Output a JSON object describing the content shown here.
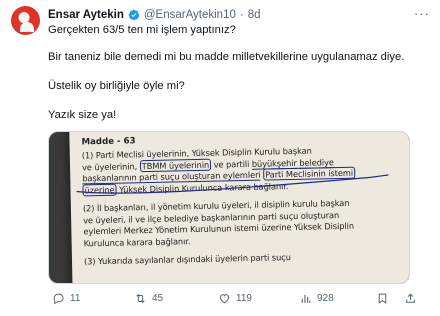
{
  "post": {
    "author_name": "Ensar Aytekin",
    "author_handle": "@EnsarAytekin10",
    "separator": "·",
    "time": "8d",
    "more_icon": "ellipsis-icon",
    "lines": [
      "Gerçekten 63/5 ten mi işlem yaptınız?",
      "Bir taneniz bile demedi mi bu  madde milletvekillerine uygulanamaz diye.",
      "Üstelik oy birliğiyle öyle mi?",
      "Yazık size ya!"
    ]
  },
  "image": {
    "title": "Madde - 63",
    "p1": {
      "l1": "(1)  Parti  Meclisi  üyelerinin,  Yüksek  Disiplin  Kurulu  başkan",
      "l2a": "ve üyelerinin,",
      "l2b": "TBMM  üyelerinin",
      "l2c": "ve  partili",
      "l2d": "büyükşehir",
      "l2e": "belediye",
      "l3a": "başkanlarının parti suçu oluşturan eylemleri",
      "l3b": "Parti Meclisinin istemi",
      "l4a": "üzerine",
      "l4b": "Yüksek  Disiplin Kurulunca karara bağlanır."
    },
    "p2": {
      "l1": "(2)  İl başkanları, il yönetim kurulu üyeleri, il disiplin kurulu başkan",
      "l2": "ve üyeleri, il ve ilçe belediye başkanlarının parti suçu oluşturan",
      "l3": "eylemleri Merkez Yönetim Kurulunun istemi üzerine Yüksek Disiplin",
      "l4": "Kurulunca karara bağlanır.",
      "l5": "(3)  Yukarıda  sayılanlar  dışındaki  üyelerin  parti  suçu"
    }
  },
  "actions": {
    "replies": "11",
    "reposts": "45",
    "likes": "119",
    "views": "928"
  },
  "colors": {
    "text": "#0f1419",
    "muted": "#536471",
    "verified": "#1d9bf0",
    "ink": "#1f2a8a",
    "paper": "#ede9de"
  }
}
